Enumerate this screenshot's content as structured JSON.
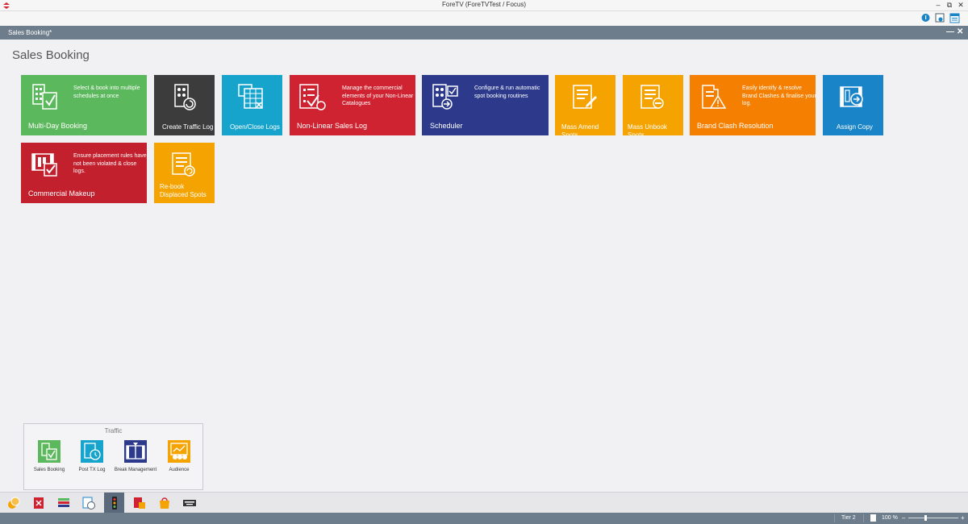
{
  "window": {
    "title": "ForeTV (ForeTVTest / Focus)",
    "controls": {
      "minimize": "–",
      "restore": "⧉",
      "close": "✕"
    }
  },
  "document": {
    "tab_title": "Sales Booking*",
    "controls": {
      "minimize": "—",
      "close": "✕"
    }
  },
  "page": {
    "title": "Sales Booking"
  },
  "tiles": [
    {
      "label": "Multi-Day Booking",
      "description": "Select & book into multiple schedules at once",
      "color": "#5cb85c",
      "icon": "multi-day-booking-icon"
    },
    {
      "label": "Create Traffic Log",
      "color": "#3c3c3c",
      "icon": "create-traffic-log-icon"
    },
    {
      "label": "Open/Close Logs",
      "color": "#16a3cc",
      "icon": "open-close-logs-icon"
    },
    {
      "label": "Non-Linear Sales Log",
      "description": "Manage the commercial elements of your Non-Linear Catalogues",
      "color": "#d02331",
      "icon": "non-linear-sales-log-icon"
    },
    {
      "label": "Scheduler",
      "description": "Configure & run automatic spot booking routines",
      "color": "#2d3a8c",
      "icon": "scheduler-icon"
    },
    {
      "label": "Mass Amend Spots",
      "color": "#f5a300",
      "icon": "mass-amend-spots-icon"
    },
    {
      "label": "Mass Unbook Spots",
      "color": "#f5a300",
      "icon": "mass-unbook-spots-icon"
    },
    {
      "label": "Brand Clash Resolution",
      "description": "Easily identify & resolve Brand Clashes & finalise your log.",
      "color": "#f57f00",
      "icon": "brand-clash-resolution-icon"
    },
    {
      "label": "Assign Copy",
      "color": "#1a84c8",
      "icon": "assign-copy-icon"
    },
    {
      "label": "Commercial Makeup",
      "description": "Ensure placement rules have not been violated & close logs.",
      "color": "#c3202e",
      "icon": "commercial-makeup-icon"
    },
    {
      "label": "Re-book Displaced Spots",
      "color": "#f5a300",
      "icon": "rebook-displaced-spots-icon"
    }
  ],
  "nav_panel": {
    "title": "Traffic",
    "items": [
      {
        "label": "Sales Booking",
        "icon": "sales-booking-icon",
        "color": "#5cb85c"
      },
      {
        "label": "Post TX Log",
        "icon": "post-tx-log-icon",
        "color": "#16a3cc"
      },
      {
        "label": "Break Management",
        "icon": "break-management-icon",
        "color": "#2d3a8c"
      },
      {
        "label": "Audience",
        "icon": "audience-icon",
        "color": "#f5a300"
      }
    ]
  },
  "status": {
    "tier": "Tier 2",
    "zoom": "100 %",
    "zoom_level": 0.35
  }
}
